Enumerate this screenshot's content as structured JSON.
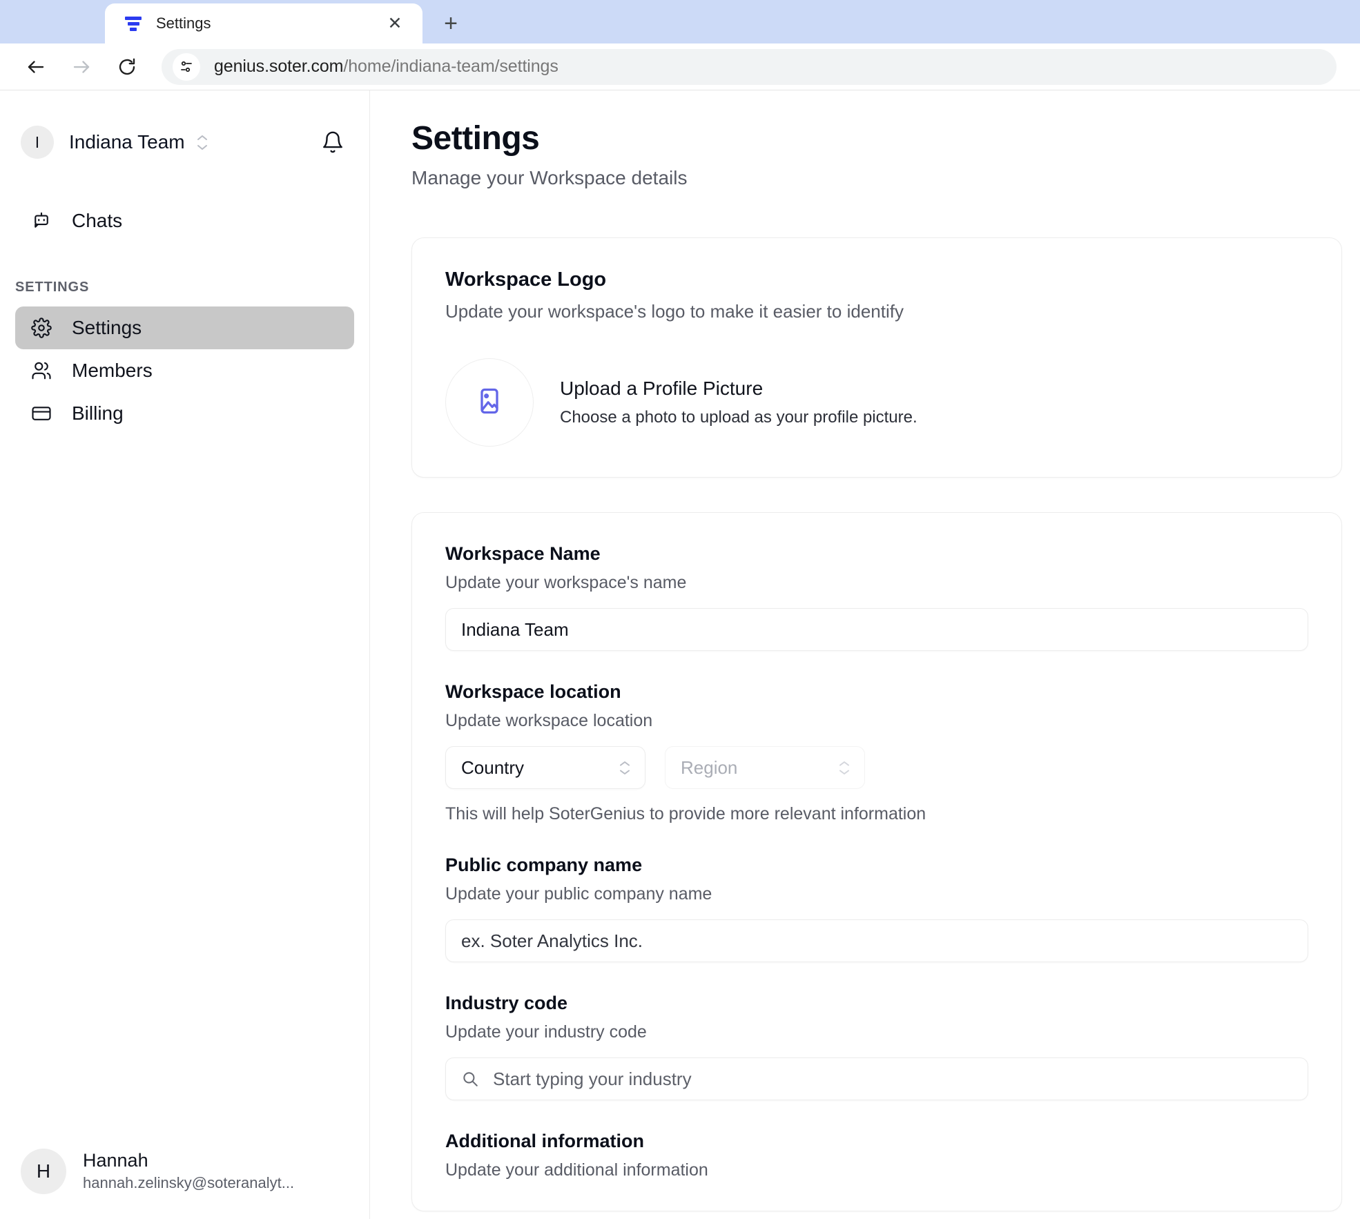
{
  "browser": {
    "tab": {
      "title": "Settings",
      "favicon": "filter-funnel-icon",
      "close_label": "✕"
    },
    "new_tab_label": "+",
    "nav": {
      "back": "back-arrow-icon",
      "forward": "forward-arrow-icon",
      "reload": "reload-icon"
    },
    "omnibox": {
      "site_info_icon": "site-settings-icon",
      "url_host": "genius.soter.com",
      "url_path": "/home/indiana-team/settings"
    }
  },
  "sidebar": {
    "workspace": {
      "avatar_initial": "I",
      "name": "Indiana Team",
      "switcher_icon": "chevron-up-down-icon",
      "bell_icon": "bell-icon"
    },
    "top_items": [
      {
        "label": "Chats",
        "icon": "chat-bot-icon",
        "active": false
      }
    ],
    "section_title": "SETTINGS",
    "items": [
      {
        "label": "Settings",
        "icon": "gear-icon",
        "active": true
      },
      {
        "label": "Members",
        "icon": "users-icon",
        "active": false
      },
      {
        "label": "Billing",
        "icon": "credit-card-icon",
        "active": false
      }
    ],
    "user": {
      "avatar_initial": "H",
      "name": "Hannah",
      "email": "hannah.zelinsky@soteranalyt..."
    }
  },
  "main": {
    "title": "Settings",
    "subtitle": "Manage your Workspace details",
    "logo_card": {
      "title": "Workspace Logo",
      "subtitle": "Update your workspace's logo to make it easier to identify",
      "upload_icon": "image-placeholder-icon",
      "upload_title": "Upload a Profile Picture",
      "upload_desc": "Choose a photo to upload as your profile picture."
    },
    "details_card": {
      "workspace_name": {
        "label": "Workspace Name",
        "help": "Update your workspace's name",
        "value": "Indiana Team"
      },
      "workspace_location": {
        "label": "Workspace location",
        "help": "Update workspace location",
        "country_value": "Country",
        "region_placeholder": "Region",
        "note": "This will help SoterGenius to provide more relevant information"
      },
      "public_company_name": {
        "label": "Public company name",
        "help": "Update your public company name",
        "placeholder": "ex. Soter Analytics Inc."
      },
      "industry_code": {
        "label": "Industry code",
        "help": "Update your industry code",
        "search_icon": "search-icon",
        "placeholder": "Start typing your industry"
      },
      "additional_information": {
        "label": "Additional information",
        "help": "Update your additional information"
      }
    }
  },
  "colors": {
    "accent": "#2b3bf0",
    "upload_icon": "#6366e8",
    "tab_strip_bg": "#ccdaf7",
    "active_nav_bg": "#c8c8c8"
  }
}
